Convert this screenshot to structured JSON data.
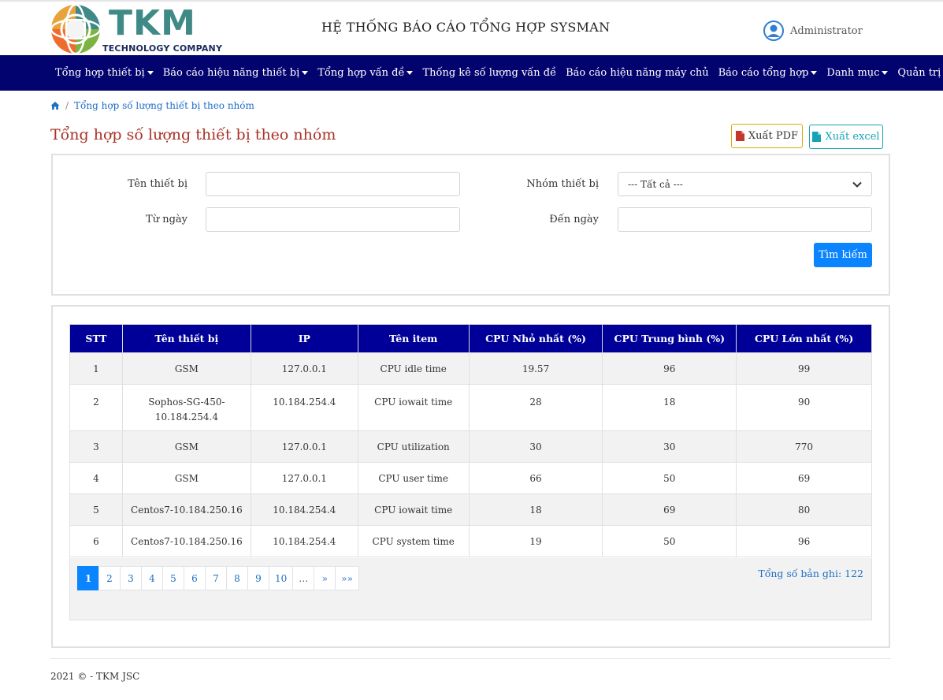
{
  "header": {
    "logo_text": "TKM",
    "logo_sub": "TECHNOLOGY COMPANY",
    "system_title": "HỆ THỐNG BÁO CÁO TỔNG HỢP SYSMAN",
    "user_name": "Administrator",
    "user_icon": "user-circle-icon"
  },
  "nav": {
    "items": [
      {
        "label": "Tổng hợp thiết bị",
        "dropdown": true
      },
      {
        "label": "Báo cáo hiệu năng thiết bị",
        "dropdown": true
      },
      {
        "label": "Tổng hợp vấn đề",
        "dropdown": true
      },
      {
        "label": "Thống kê số lượng vấn đề",
        "dropdown": false
      },
      {
        "label": "Báo cáo hiệu năng máy chủ",
        "dropdown": false
      },
      {
        "label": "Báo cáo tổng hợp",
        "dropdown": true
      },
      {
        "label": "Danh mục",
        "dropdown": true
      },
      {
        "label": "Quản trị",
        "dropdown": true
      }
    ]
  },
  "breadcrumb": {
    "home_icon": "home-icon",
    "current": "Tổng hợp số lượng thiết bị theo nhóm"
  },
  "page": {
    "title": "Tổng hợp số lượng thiết bị theo nhóm",
    "export_pdf": "Xuất PDF",
    "export_excel": "Xuất excel"
  },
  "filters": {
    "device_name_label": "Tên thiết bị",
    "device_name_value": "",
    "group_label": "Nhóm thiết bị",
    "group_selected": "--- Tất cả ---",
    "from_label": "Từ ngày",
    "from_value": "",
    "to_label": "Đến ngày",
    "to_value": "",
    "search_button": "Tìm kiếm"
  },
  "table": {
    "columns": [
      "STT",
      "Tên thiết bị",
      "IP",
      "Tên item",
      "CPU Nhỏ nhất (%)",
      "CPU Trung bình (%)",
      "CPU Lớn nhất (%)"
    ],
    "rows": [
      [
        "1",
        "GSM",
        "127.0.0.1",
        "CPU idle time",
        "19.57",
        "96",
        "99"
      ],
      [
        "2",
        "Sophos-SG-450-10.184.254.4",
        "10.184.254.4",
        "CPU iowait time",
        "28",
        "18",
        "90"
      ],
      [
        "3",
        "GSM",
        "127.0.0.1",
        "CPU utilization",
        "30",
        "30",
        "770"
      ],
      [
        "4",
        "GSM",
        "127.0.0.1",
        "CPU user time",
        "66",
        "50",
        "69"
      ],
      [
        "5",
        "Centos7-10.184.250.16",
        "10.184.254.4",
        "CPU iowait time",
        "18",
        "69",
        "80"
      ],
      [
        "6",
        "Centos7-10.184.250.16",
        "10.184.254.4",
        "CPU system time",
        "19",
        "50",
        "96"
      ]
    ]
  },
  "pagination": {
    "pages": [
      "1",
      "2",
      "3",
      "4",
      "5",
      "6",
      "7",
      "8",
      "9",
      "10",
      "…",
      "»",
      "»»"
    ],
    "active": "1",
    "total_label": "Tổng số bản ghi: 122"
  },
  "footer": {
    "text": "2021 © - TKM JSC"
  }
}
